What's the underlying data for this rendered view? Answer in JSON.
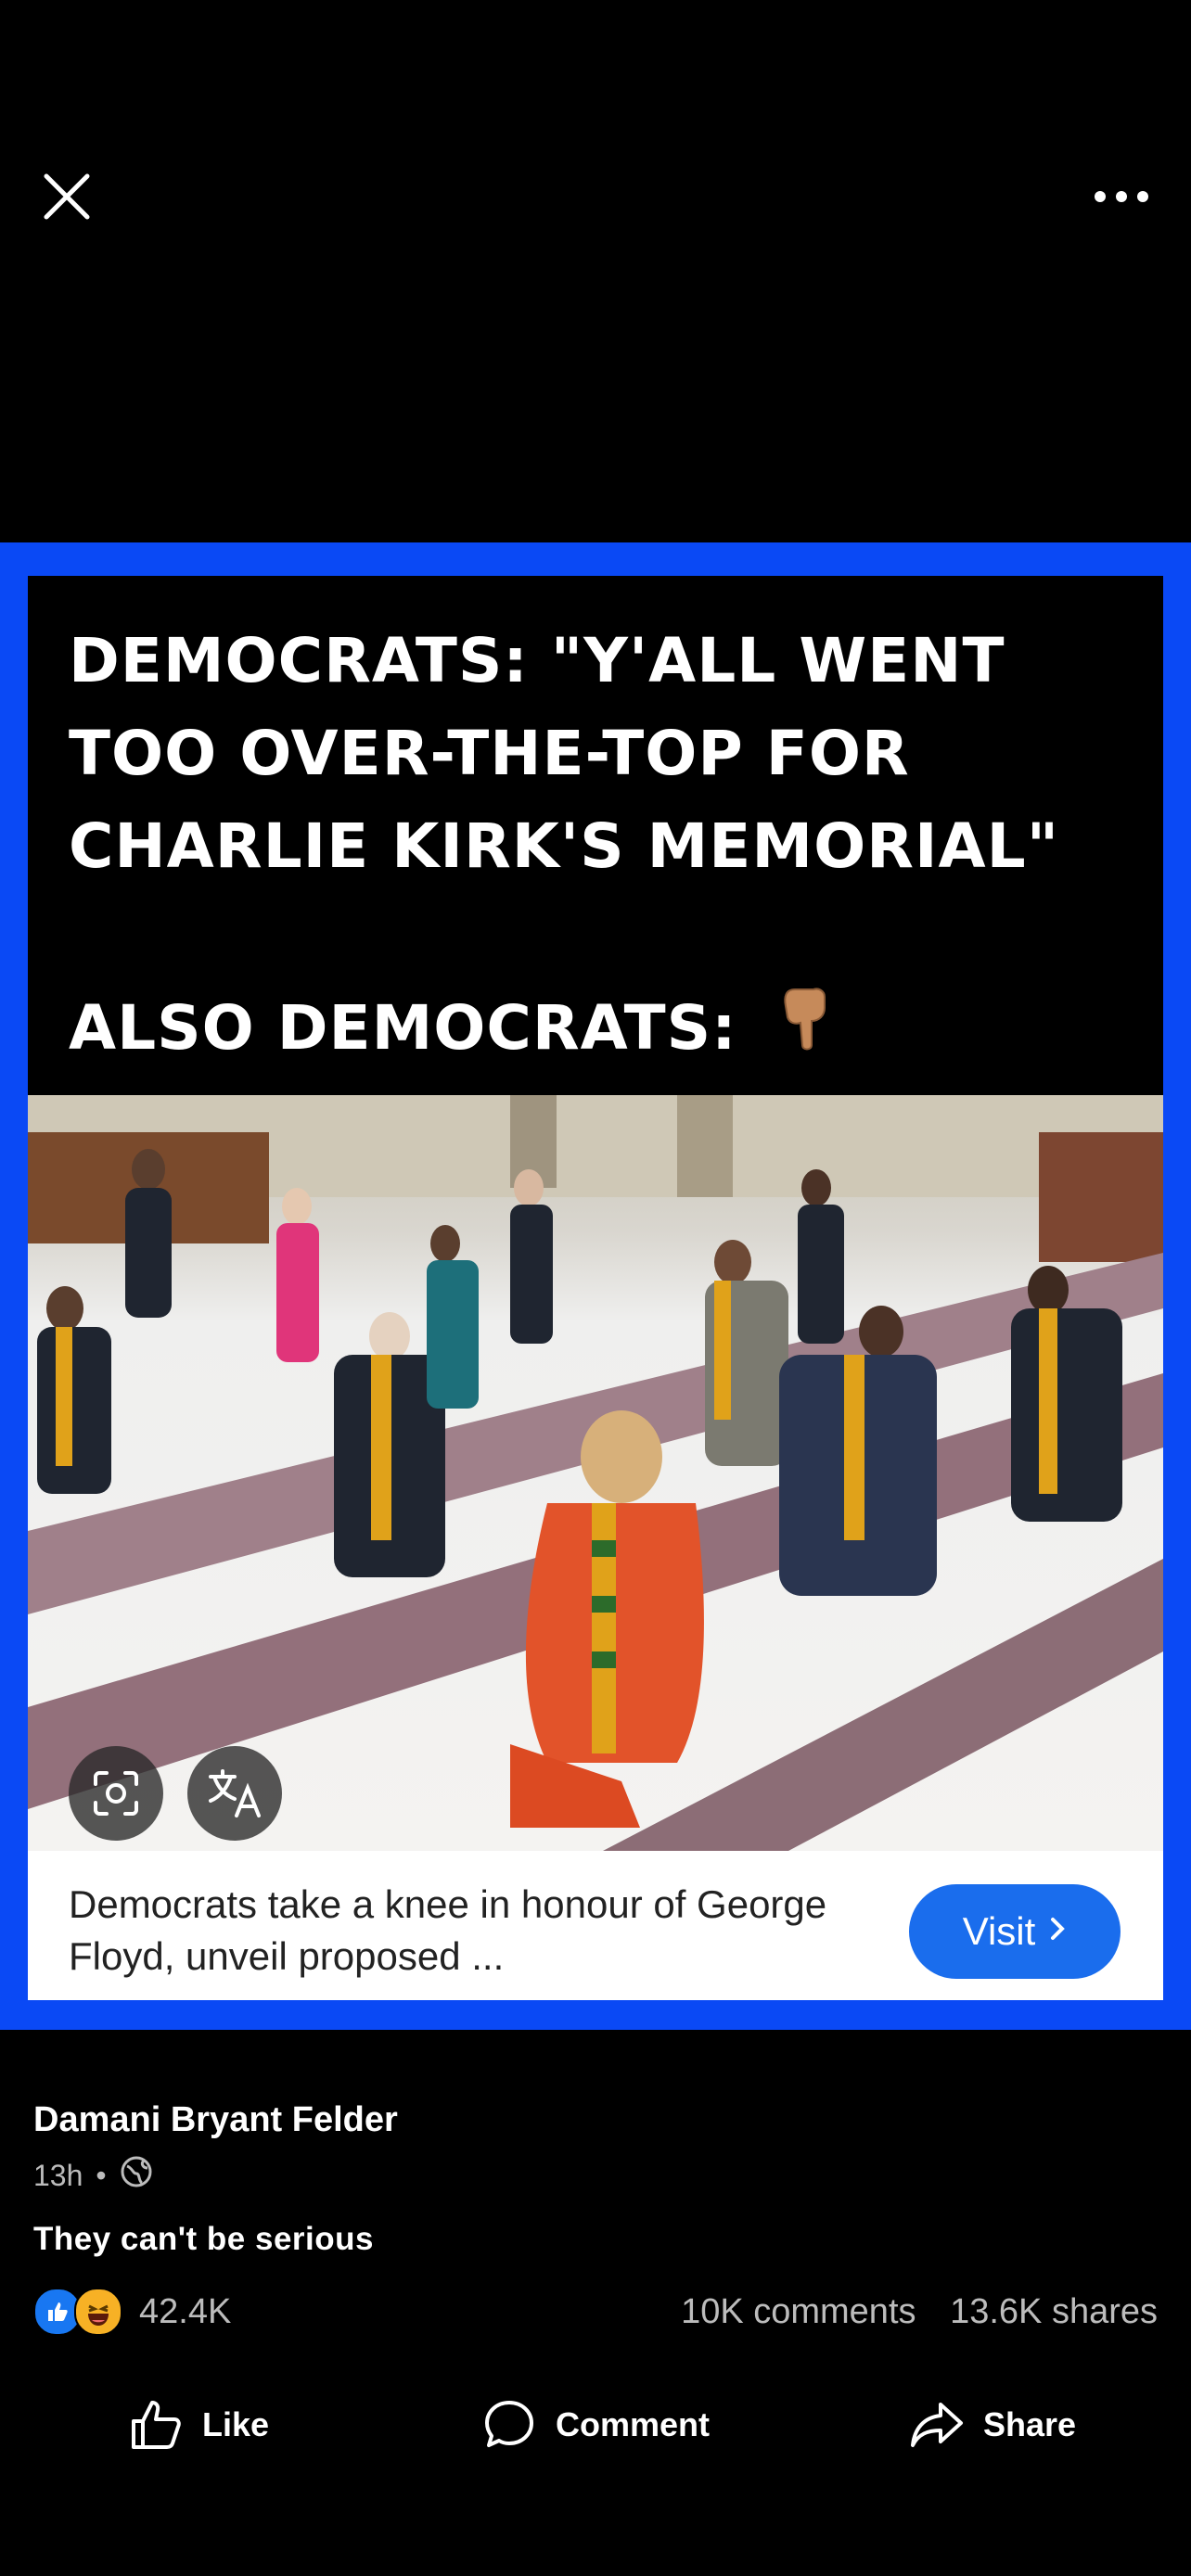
{
  "meme": {
    "line1": "DEMOCRATS: \"Y'ALL WENT",
    "line2": "TOO OVER-THE-TOP FOR",
    "line3": "CHARLIE KIRK'S MEMORIAL\"",
    "line4": "ALSO DEMOCRATS:",
    "emoji": "pointing-down-hand-icon"
  },
  "link_preview": {
    "title": "Democrats take a knee in honour of George Floyd, unveil proposed ...",
    "visit_label": "Visit"
  },
  "post": {
    "author": "Damani Bryant Felder",
    "time": "13h",
    "visibility_icon": "globe-icon",
    "caption": "They can't be serious",
    "reaction_count": "42.4K",
    "comments": "10K comments",
    "shares": "13.6K shares"
  },
  "actions": {
    "like": "Like",
    "comment": "Comment",
    "share": "Share"
  },
  "colors": {
    "frame_blue": "#0a49f5",
    "visit_blue": "#1a6ded",
    "like_blue": "#1877f2",
    "haha_yellow": "#f7b125"
  }
}
